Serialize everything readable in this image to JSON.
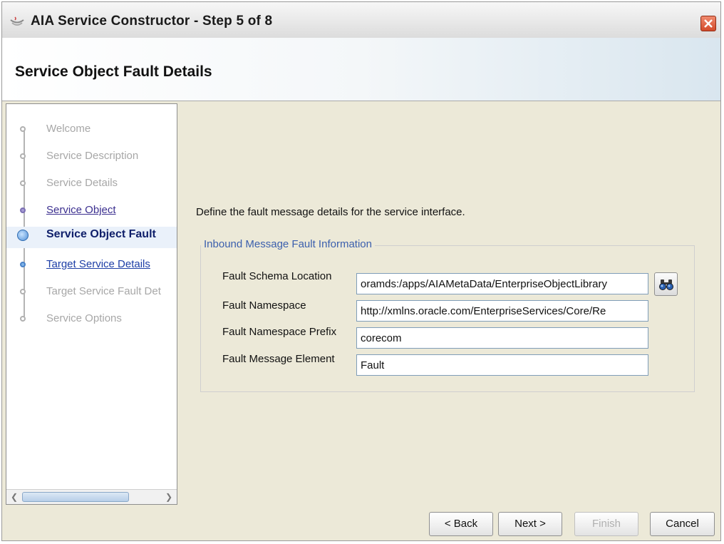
{
  "window": {
    "title": "AIA Service Constructor - Step 5 of 8"
  },
  "header": {
    "page_title": "Service Object Fault Details"
  },
  "nav": {
    "items": [
      {
        "label": "Welcome",
        "state": "pending"
      },
      {
        "label": "Service Description",
        "state": "pending"
      },
      {
        "label": "Service Details",
        "state": "pending"
      },
      {
        "label": "Service Object",
        "state": "visited"
      },
      {
        "label": "Service Object Fault",
        "state": "current"
      },
      {
        "label": "Target Service Details",
        "state": "next"
      },
      {
        "label": "Target Service Fault Det",
        "state": "pending"
      },
      {
        "label": "Service Options",
        "state": "pending"
      }
    ]
  },
  "main": {
    "instruction": "Define the fault message details for the service interface.",
    "group_title": "Inbound Message Fault Information",
    "fields": [
      {
        "label": "Fault Schema Location",
        "value": "oramds:/apps/AIAMetaData/EnterpriseObjectLibrary"
      },
      {
        "label": "Fault Namespace",
        "value": "http://xmlns.oracle.com/EnterpriseServices/Core/Re"
      },
      {
        "label": "Fault Namespace Prefix",
        "value": "corecom"
      },
      {
        "label": "Fault Message Element",
        "value": "Fault"
      }
    ]
  },
  "buttons": {
    "back": "< Back",
    "next": "Next >",
    "finish": "Finish",
    "cancel": "Cancel"
  },
  "icons": {
    "app": "coffee-cup-icon",
    "close": "close-icon",
    "browse": "binoculars-icon"
  },
  "colors": {
    "accent": "#3b5fad",
    "close_button": "#d34a2a",
    "current_step": "#0f1f6a"
  }
}
